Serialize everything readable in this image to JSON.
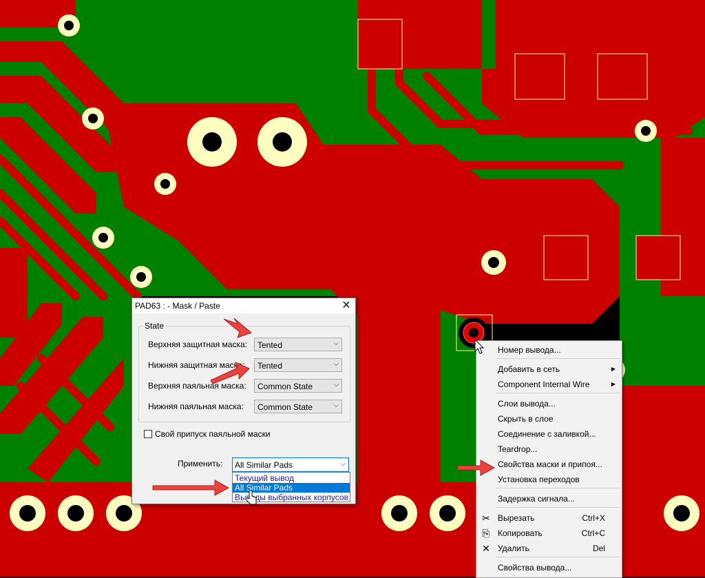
{
  "dialog": {
    "title": "PAD63 :  - Mask / Paste",
    "close_glyph": "✕",
    "group_title": "State",
    "rows": [
      {
        "label": "Верхняя защитная маска:",
        "value": "Tented"
      },
      {
        "label": "Нижняя защитная маска:",
        "value": "Tented"
      },
      {
        "label": "Верхняя паяльная маска:",
        "value": "Common State"
      },
      {
        "label": "Нижняя паяльная маска:",
        "value": "Common State"
      }
    ],
    "checkbox_label": "Свой припуск паяльной маски",
    "apply_label": "Применить:",
    "apply_value": "All Similar Pads",
    "apply_options": [
      "Текущий вывод",
      "All Similar Pads",
      "Выводы выбранных корпусов"
    ],
    "apply_selected": "All Similar Pads"
  },
  "context_menu": {
    "items": [
      {
        "label": "Номер вывода...",
        "shortcut": "",
        "submenu": false,
        "icon": ""
      },
      {
        "label": "Добавить в сеть",
        "shortcut": "",
        "submenu": true,
        "icon": ""
      },
      {
        "label": "Component Internal Wire",
        "shortcut": "",
        "submenu": true,
        "icon": ""
      },
      {
        "label": "Слои вывода...",
        "shortcut": "",
        "submenu": false,
        "icon": ""
      },
      {
        "label": "Скрыть в слое",
        "shortcut": "",
        "submenu": false,
        "icon": ""
      },
      {
        "label": "Соединение с заливкой...",
        "shortcut": "",
        "submenu": false,
        "icon": ""
      },
      {
        "label": "Teardrop...",
        "shortcut": "",
        "submenu": false,
        "icon": ""
      },
      {
        "label": "Свойства маски и припоя...",
        "shortcut": "",
        "submenu": false,
        "icon": ""
      },
      {
        "label": "Установка переходов",
        "shortcut": "",
        "submenu": false,
        "icon": ""
      },
      {
        "label": "Задержка сигнала...",
        "shortcut": "",
        "submenu": false,
        "icon": ""
      },
      {
        "label": "Вырезать",
        "shortcut": "Ctrl+X",
        "submenu": false,
        "icon": "scissors-icon"
      },
      {
        "label": "Копировать",
        "shortcut": "Ctrl+C",
        "submenu": false,
        "icon": "copy-icon"
      },
      {
        "label": "Удалить",
        "shortcut": "Del",
        "submenu": false,
        "icon": "delete-x-icon"
      },
      {
        "label": "Свойства вывода...",
        "shortcut": "",
        "submenu": false,
        "icon": ""
      }
    ],
    "submenu_glyph": "▶"
  },
  "icons": {
    "combo_arrow": "⌵",
    "scissors": "✂",
    "copy": "⎘",
    "delete": "✕"
  },
  "colors": {
    "board_bg": "#000000",
    "copper": "#cc0000",
    "clearance": "#008000",
    "pad_ring": "#ffffc0",
    "annotation_arrow": "#e8433f",
    "selection": "#0078d7"
  }
}
